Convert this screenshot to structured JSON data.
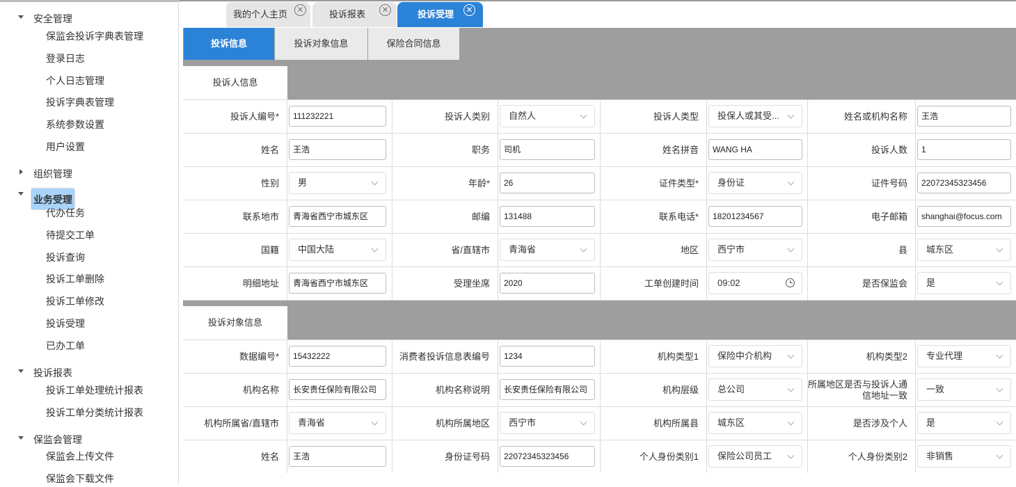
{
  "sidebar": {
    "groups": [
      {
        "label": "安全管理",
        "items": [
          "保监会投诉字典表管理",
          "登录日志",
          "个人日志管理",
          "投诉字典表管理",
          "系统参数设置",
          "用户设置"
        ]
      },
      {
        "label": "组织管理",
        "items": []
      },
      {
        "label": "业务受理",
        "items": [
          "代办任务",
          "待提交工单",
          "投诉查询",
          "投诉工单删除",
          "投诉工单修改",
          "投诉受理",
          "已办工单"
        ]
      },
      {
        "label": "投诉报表",
        "items": [
          "投诉工单处理统计报表",
          "投诉工单分类统计报表"
        ]
      },
      {
        "label": "保监会管理",
        "items": [
          "保监会上传文件",
          "保监会下载文件"
        ]
      }
    ]
  },
  "tabs": [
    "我的个人主页",
    "投诉报表",
    "投诉受理"
  ],
  "subtabs": [
    "投诉信息",
    "投诉对象信息",
    "保险合同信息"
  ],
  "section1": {
    "title": "投诉人信息",
    "rows": [
      [
        {
          "l": "投诉人编号*",
          "v": "111232221",
          "t": "input"
        },
        {
          "l": "投诉人类别",
          "v": "自然人",
          "t": "select"
        },
        {
          "l": "投诉人类型",
          "v": "投保人或其受...",
          "t": "select"
        },
        {
          "l": "姓名或机构名称",
          "v": "王浩",
          "t": "input"
        }
      ],
      [
        {
          "l": "姓名",
          "v": "王浩",
          "t": "input"
        },
        {
          "l": "职务",
          "v": "司机",
          "t": "input"
        },
        {
          "l": "姓名拼音",
          "v": "WANG HA",
          "t": "input"
        },
        {
          "l": "投诉人数",
          "v": "1",
          "t": "input"
        }
      ],
      [
        {
          "l": "性别",
          "v": "男",
          "t": "select"
        },
        {
          "l": "年龄*",
          "v": "26",
          "t": "input"
        },
        {
          "l": "证件类型*",
          "v": "身份证",
          "t": "select"
        },
        {
          "l": "证件号码",
          "v": "22072345323456",
          "t": "input"
        }
      ],
      [
        {
          "l": "联系地市",
          "v": "青海省西宁市城东区",
          "t": "input"
        },
        {
          "l": "邮编",
          "v": "131488",
          "t": "input"
        },
        {
          "l": "联系电话*",
          "v": "18201234567",
          "t": "input"
        },
        {
          "l": "电子邮箱",
          "v": "shanghai@focus.com",
          "t": "input"
        }
      ],
      [
        {
          "l": "国籍",
          "v": "中国大陆",
          "t": "select"
        },
        {
          "l": "省/直辖市",
          "v": "青海省",
          "t": "select"
        },
        {
          "l": "地区",
          "v": "西宁市",
          "t": "select"
        },
        {
          "l": "县",
          "v": "城东区",
          "t": "select"
        }
      ],
      [
        {
          "l": "明细地址",
          "v": "青海省西宁市城东区",
          "t": "input"
        },
        {
          "l": "受理坐席",
          "v": "2020",
          "t": "input"
        },
        {
          "l": "工单创建时间",
          "v": "09:02",
          "t": "time"
        },
        {
          "l": "是否保监会",
          "v": "是",
          "t": "select"
        }
      ]
    ]
  },
  "section2": {
    "title": "投诉对象信息",
    "rows": [
      [
        {
          "l": "数据编号*",
          "v": "15432222",
          "t": "input"
        },
        {
          "l": "消费者投诉信息表编号",
          "v": "1234",
          "t": "input"
        },
        {
          "l": "机构类型1",
          "v": "保险中介机构",
          "t": "select"
        },
        {
          "l": "机构类型2",
          "v": "专业代理",
          "t": "select"
        }
      ],
      [
        {
          "l": "机构名称",
          "v": "长安责任保险有限公司",
          "t": "input"
        },
        {
          "l": "机构名称说明",
          "v": "长安责任保险有限公司",
          "t": "input"
        },
        {
          "l": "机构层级",
          "v": "总公司",
          "t": "select"
        },
        {
          "l": "所属地区是否与投诉人通信地址一致",
          "v": "一致",
          "t": "select"
        }
      ],
      [
        {
          "l": "机构所属省/直辖市",
          "v": "青海省",
          "t": "select"
        },
        {
          "l": "机构所属地区",
          "v": "西宁市",
          "t": "select"
        },
        {
          "l": "机构所属县",
          "v": "城东区",
          "t": "select"
        },
        {
          "l": "是否涉及个人",
          "v": "是",
          "t": "select"
        }
      ],
      [
        {
          "l": "姓名",
          "v": "王浩",
          "t": "input"
        },
        {
          "l": "身份证号码",
          "v": "22072345323456",
          "t": "input"
        },
        {
          "l": "个人身份类别1",
          "v": "保险公司员工",
          "t": "select"
        },
        {
          "l": "个人身份类别2",
          "v": "非销售",
          "t": "select"
        }
      ]
    ]
  }
}
